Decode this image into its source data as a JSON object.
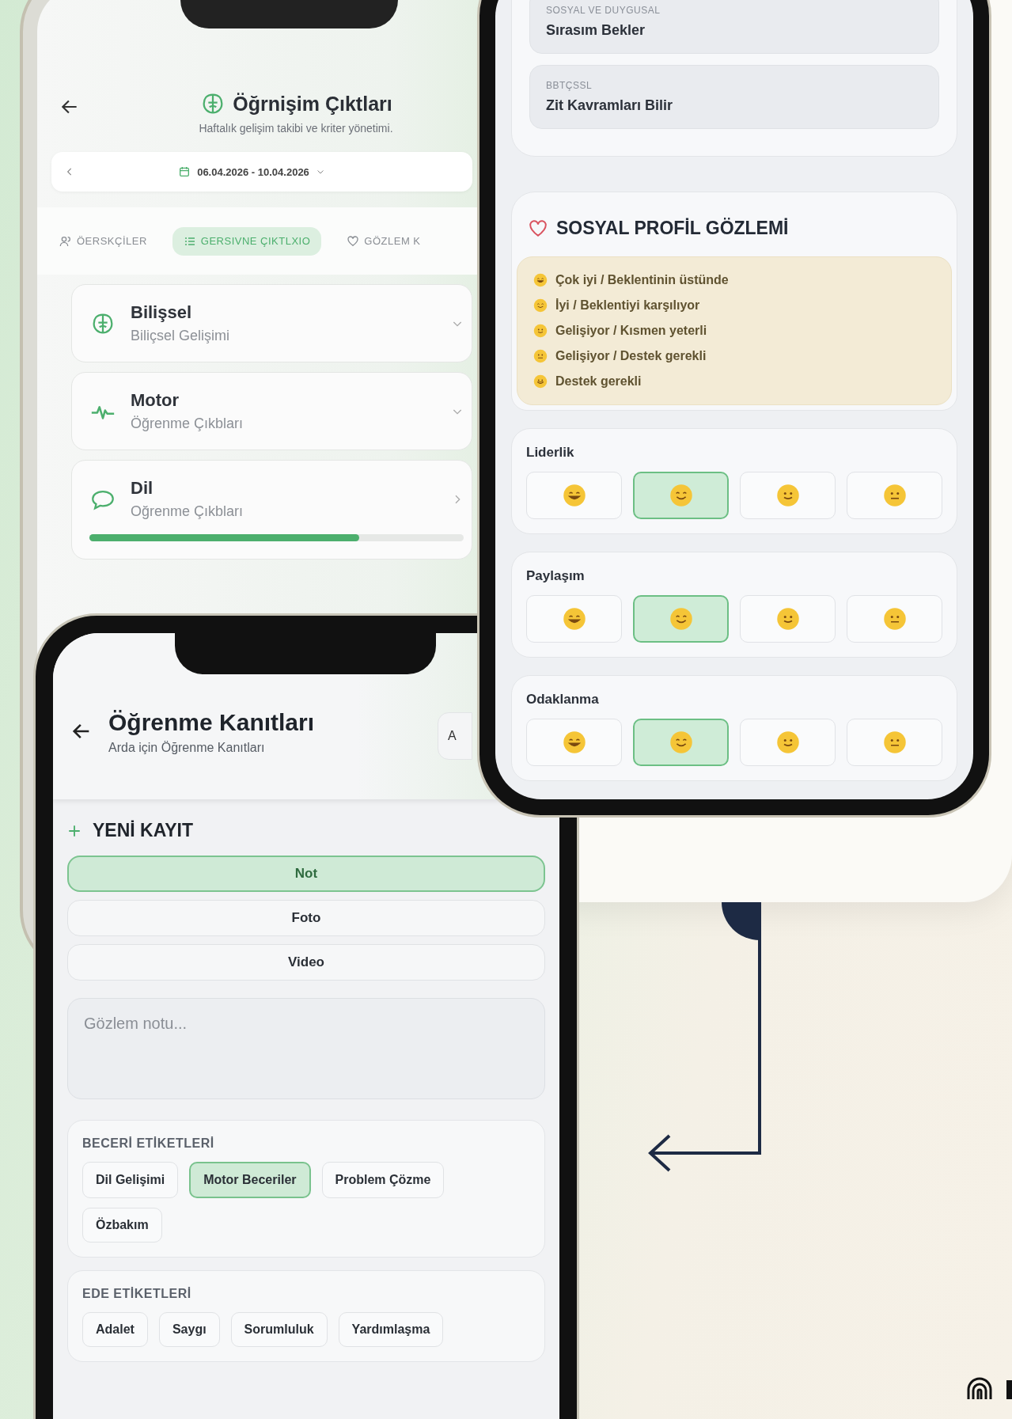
{
  "left_phone": {
    "title": "Öğrnişim Çıktları",
    "subtitle": "Haftalık gelişim takibi ve kriter yönetimi.",
    "date_range": "06.04.2026 - 10.04.2026",
    "tabs": [
      {
        "label": "ÖERSKÇİLER",
        "selected": false
      },
      {
        "label": "GERSIVNE ÇIKTLXIO",
        "selected": true
      },
      {
        "label": "GÖZLEM K",
        "selected": false
      }
    ],
    "domains": [
      {
        "title": "Bilişsel",
        "subtitle": "Biliçsel Gelişimi"
      },
      {
        "title": "Motor",
        "subtitle": "Öğrenme Çıkbları"
      },
      {
        "title": "Dil",
        "subtitle": "Oğrenme Çıkbları",
        "level": 0.72
      }
    ]
  },
  "right_phone": {
    "outcomes": [
      {
        "category": "SOSYAL VE DUYGUSAL",
        "title": "Sırasım Bekler"
      },
      {
        "category": "BBTÇSSL",
        "title": "Zit Kavramları Bilir"
      }
    ],
    "profile": {
      "title": "SOSYAL PROFİL GÖZLEMİ",
      "legend": [
        "Çok iyi / Beklentinin üstünde",
        "İyi / Beklentiyi karşılıyor",
        "Gelişiyor / Kısmen yeterli",
        "Gelişiyor / Destek gerekli",
        "Destek gerekli"
      ],
      "ratings": [
        {
          "label": "Liderlik",
          "options": [
            {
              "selected": false
            },
            {
              "selected": true
            },
            {
              "selected": false
            },
            {
              "selected": false
            }
          ]
        },
        {
          "label": "Paylaşım",
          "options": [
            {
              "selected": false
            },
            {
              "selected": true
            },
            {
              "selected": false
            },
            {
              "selected": false
            }
          ]
        },
        {
          "label": "Odaklanma",
          "options": [
            {
              "selected": false
            },
            {
              "selected": true
            },
            {
              "selected": false
            },
            {
              "selected": false
            }
          ]
        }
      ]
    }
  },
  "bottom_phone": {
    "title": "Öğrenme Kanıtları",
    "subtitle": "Arda için Öğrenme Kanıtları",
    "action": "A",
    "new_entry": {
      "title": "YENİ KAYIT",
      "types": [
        {
          "label": "Not",
          "selected": true
        },
        {
          "label": "Foto",
          "selected": false
        },
        {
          "label": "Video",
          "selected": false
        }
      ],
      "note": {
        "placeholder": "Gözlem notu..."
      }
    },
    "tag_groups": [
      {
        "title": "BECERİ ETİKETLERİ",
        "tags": [
          {
            "label": "Dil Gelişimi",
            "selected": false
          },
          {
            "label": "Motor Beceriler",
            "selected": true
          },
          {
            "label": "Problem Çözme",
            "selected": false
          },
          {
            "label": "Özbakım",
            "selected": false
          }
        ]
      },
      {
        "title": "EDE ETİKETLERİ",
        "tags": [
          {
            "label": "Adalet",
            "selected": false
          },
          {
            "label": "Saygı",
            "selected": false
          },
          {
            "label": "Sorumluluk",
            "selected": false
          },
          {
            "label": "Yardımlaşma",
            "selected": false
          }
        ]
      }
    ]
  }
}
